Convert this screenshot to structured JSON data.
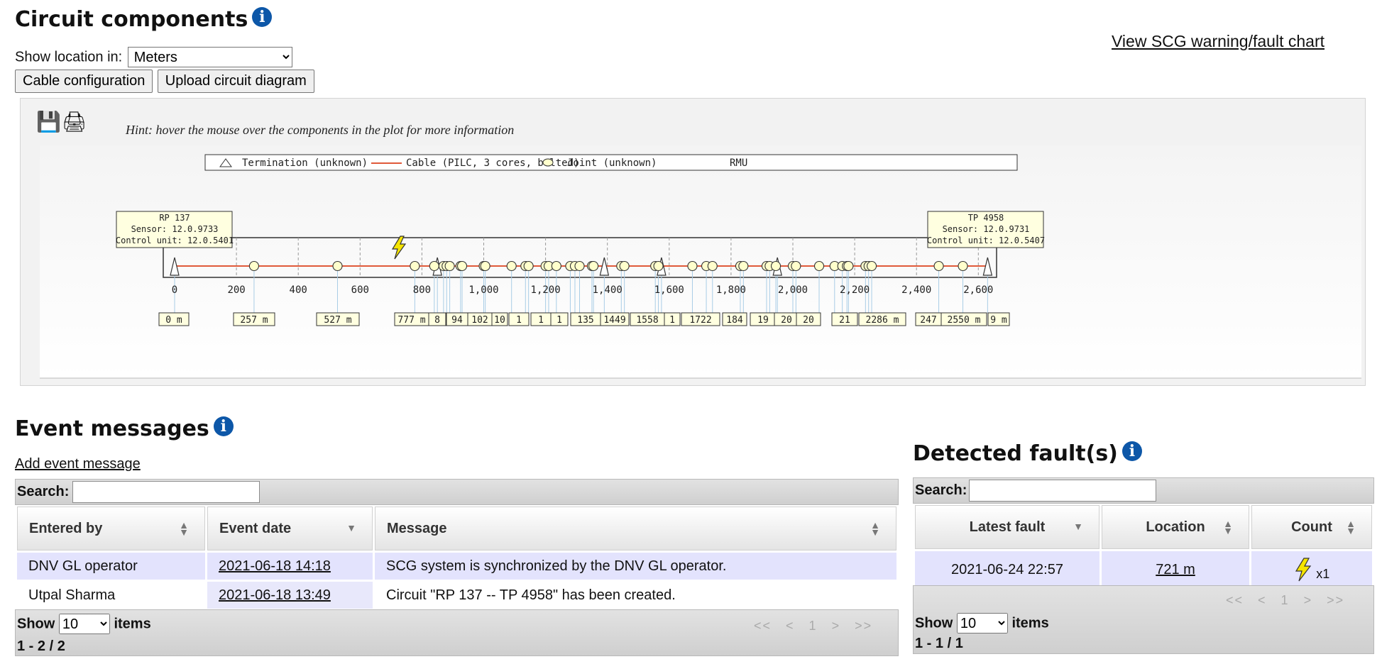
{
  "circuit": {
    "title": "Circuit components",
    "location_label": "Show location in:",
    "location_value": "Meters",
    "cable_config_button": "Cable configuration",
    "upload_button": "Upload circuit diagram",
    "chart_link": "View SCG warning/fault chart",
    "hint": "Hint: hover the mouse over the components in the plot for more information"
  },
  "icons": {
    "info": "info-icon",
    "save": "save-icon",
    "print": "print-icon",
    "fault": "lightning-bolt-icon"
  },
  "plot": {
    "legend": {
      "termination": "Termination (unknown)",
      "cable": "Cable (PILC, 3 cores, belted)",
      "joint": "Joint (unknown)",
      "rmu": "RMU"
    },
    "start_box": {
      "name": "RP 137",
      "sensor": "Sensor: 12.0.9733",
      "control": "Control unit: 12.0.5401"
    },
    "end_box": {
      "name": "TP 4958",
      "sensor": "Sensor: 12.0.9731",
      "control": "Control unit: 12.0.5407"
    },
    "axis_ticks": [
      "0",
      "200",
      "400",
      "600",
      "800",
      "1,000",
      "1,200",
      "1,400",
      "1,600",
      "1,800",
      "2,000",
      "2,200",
      "2,400",
      "2,600"
    ],
    "axis_range": [
      0,
      2650
    ],
    "fault_location_m": 721,
    "terminations_m": [
      0,
      850,
      1390,
      1575,
      1950,
      2630
    ],
    "joints_m": [
      257,
      527,
      777,
      840,
      870,
      880,
      890,
      925,
      930,
      1000,
      1005,
      1090,
      1135,
      1145,
      1200,
      1210,
      1235,
      1280,
      1295,
      1310,
      1350,
      1355,
      1445,
      1455,
      1555,
      1565,
      1675,
      1720,
      1740,
      1830,
      1840,
      1915,
      1925,
      1945,
      2000,
      2010,
      2085,
      2135,
      2160,
      2175,
      2180,
      2235,
      2245,
      2255,
      2472,
      2550
    ],
    "distance_labels": [
      "0 m",
      "257 m",
      "527 m",
      "777 m",
      "8",
      "94",
      "102",
      "10",
      "1",
      "1",
      "1",
      "135",
      "1449",
      "1558",
      "1",
      "1722",
      "184",
      "19",
      "20",
      "20",
      "21",
      "2286 m",
      "247",
      "2550 m",
      "9 m"
    ]
  },
  "events": {
    "title": "Event messages",
    "add_link": "Add event message",
    "search_label": "Search:",
    "columns": [
      "Entered by",
      "Event date",
      "Message"
    ],
    "rows": [
      {
        "by": "DNV GL operator",
        "date": "2021-06-18 14:18",
        "message": "SCG system is synchronized by the DNV GL operator."
      },
      {
        "by": "Utpal Sharma",
        "date": "2021-06-18 13:49",
        "message": "Circuit \"RP 137 -- TP 4958\" has been created."
      }
    ],
    "show_label": "Show",
    "page_size": "10",
    "items_label": "items",
    "pager": [
      "<<",
      "<",
      "1",
      ">",
      ">>"
    ],
    "range": "1 - 2 / 2"
  },
  "faults": {
    "title": "Detected fault(s)",
    "search_label": "Search:",
    "columns": [
      "Latest fault",
      "Location",
      "Count"
    ],
    "rows": [
      {
        "latest": "2021-06-24 22:57",
        "location": "721 m",
        "count": "x1"
      }
    ],
    "show_label": "Show",
    "page_size": "10",
    "items_label": "items",
    "pager": [
      "<<",
      "<",
      "1",
      ">",
      ">>"
    ],
    "range": "1 - 1 / 1"
  },
  "colors": {
    "cable": "#e05a3a",
    "joint_fill": "#ffffcc",
    "fault_bolt": "#f5e400",
    "info_blue": "#0d57a8",
    "row_highlight": "#e3e3fd"
  }
}
